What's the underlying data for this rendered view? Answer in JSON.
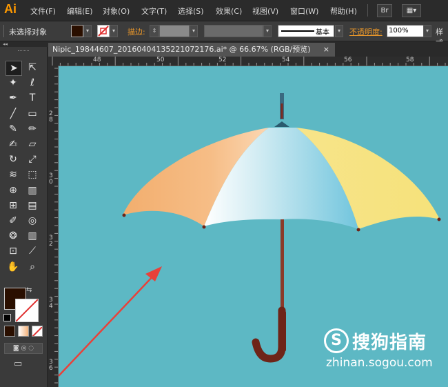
{
  "app": {
    "logo": "Ai"
  },
  "menu": [
    "文件(F)",
    "编辑(E)",
    "对象(O)",
    "文字(T)",
    "选择(S)",
    "效果(C)",
    "视图(V)",
    "窗口(W)",
    "帮助(H)"
  ],
  "top_right": {
    "bridge": "Br",
    "workspace": "▦▾"
  },
  "control": {
    "selection_status": "未选择对象",
    "stroke_label": "描边:",
    "stroke_style": "基本",
    "opacity_label": "不透明度:",
    "opacity_value": "100%",
    "style_label": "样式",
    "fill_color": "#2a0f00"
  },
  "document": {
    "tab_title": "Nipic_19844607_20160404135221072176.ai*  @  66.67%  (RGB/预览)",
    "close": "×"
  },
  "ruler": {
    "h_labels": [
      "48",
      "50",
      "52",
      "54",
      "56",
      "58"
    ],
    "v_labels": [
      "2\n8",
      "3\n0",
      "3\n2",
      "3\n4",
      "3\n6"
    ]
  },
  "canvas": {
    "background": "#5db8c4"
  },
  "watermark": {
    "brand": "搜狗指南",
    "url": "zhinan.sogou.com"
  },
  "tools": {
    "toolbar_collapse": "◂◂",
    "items": [
      "selection-icon",
      "direct-selection-icon",
      "magic-wand-icon",
      "lasso-icon",
      "pen-icon",
      "type-icon",
      "line-icon",
      "rectangle-icon",
      "paintbrush-icon",
      "pencil-icon",
      "blob-brush-icon",
      "eraser-icon",
      "rotate-icon",
      "scale-icon",
      "warp-icon",
      "free-transform-icon",
      "shape-builder-icon",
      "graph-icon",
      "mesh-icon",
      "gradient-icon",
      "eyedropper-icon",
      "blend-icon",
      "symbol-sprayer-icon",
      "column-graph-icon",
      "artboard-icon",
      "slice-icon",
      "hand-icon",
      "zoom-icon"
    ]
  }
}
